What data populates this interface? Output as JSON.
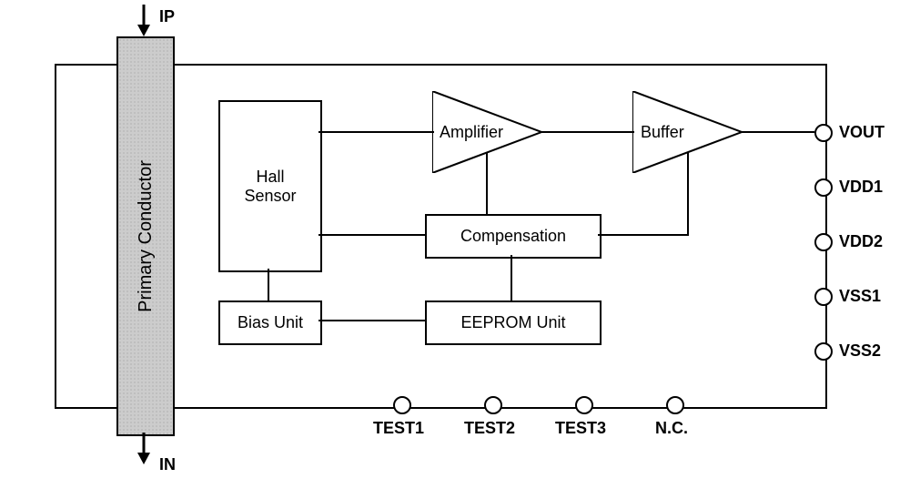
{
  "labels": {
    "ip": "IP",
    "in": "IN",
    "primary_conductor": "Primary Conductor",
    "hall_sensor": "Hall\nSensor",
    "amplifier": "Amplifier",
    "buffer": "Buffer",
    "compensation": "Compensation",
    "bias_unit": "Bias Unit",
    "eeprom_unit": "EEPROM Unit",
    "pins_right": {
      "vout": "VOUT",
      "vdd1": "VDD1",
      "vdd2": "VDD2",
      "vss1": "VSS1",
      "vss2": "VSS2"
    },
    "pins_bottom": {
      "test1": "TEST1",
      "test2": "TEST2",
      "test3": "TEST3",
      "nc": "N.C."
    }
  }
}
